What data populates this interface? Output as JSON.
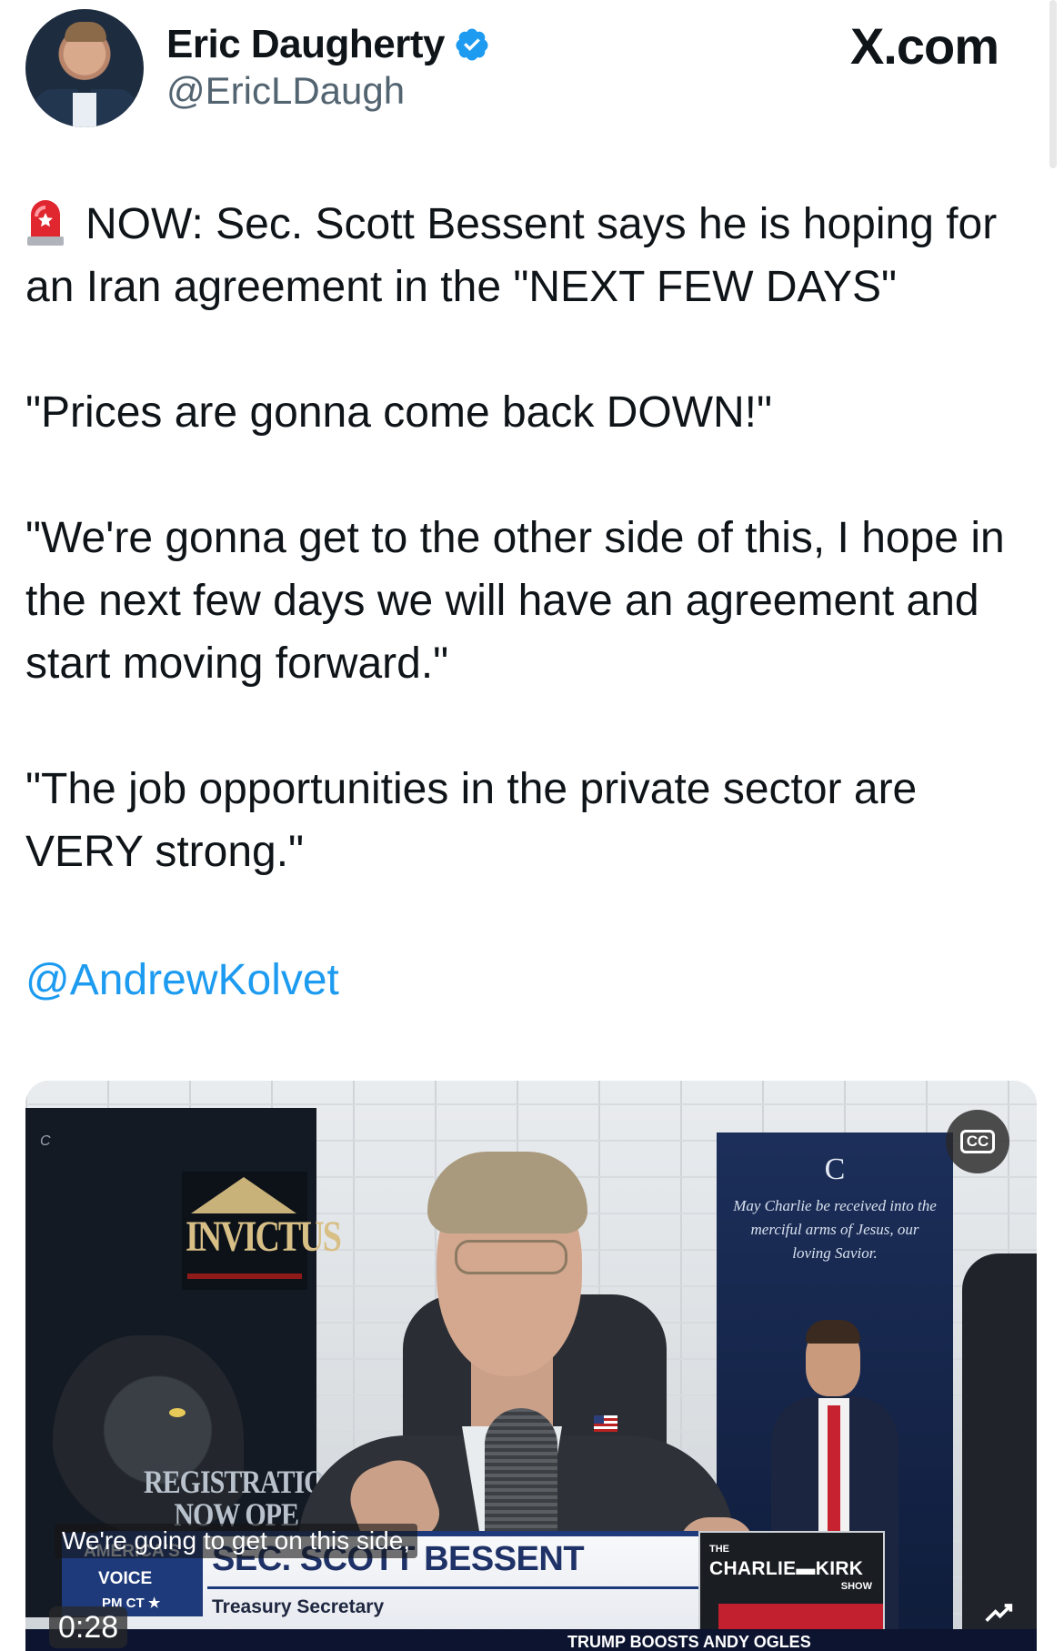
{
  "author": {
    "display_name": "Eric Daugherty",
    "handle": "@EricLDaugh",
    "verified": true
  },
  "brand": "X.com",
  "tweet": {
    "lines": [
      "NOW: Sec. Scott Bessent says he is hoping for an Iran agreement in the \"NEXT FEW DAYS\"",
      "\"Prices are gonna come back DOWN!\"",
      "\"We're gonna get to the other side of this, I hope in the next few days we will have an agreement and start moving forward.\"",
      "\"The job opportunities in the private sector are VERY strong.\""
    ],
    "mention": "@AndrewKolvet"
  },
  "video": {
    "caption": "We're going to get on this side,",
    "timestamp": "0:28",
    "cc_label": "CC",
    "lower_third_name": "SEC. SCOTT BESSENT",
    "lower_third_title": "Treasury Secretary",
    "network_line1": "AMERICA'S",
    "network_line2": "VOICE",
    "network_tz": "PM CT ★",
    "show_the": "THE",
    "show_name": "CHARLIE▬KIRK",
    "show_suffix": "SHOW",
    "ticker": "TRUMP BOOSTS ANDY OGLES",
    "poster_left_title": "INVICTUS",
    "poster_left_reg": "REGISTRATIO NOW OPE",
    "poster_right_quote": "May Charlie be received into the merciful arms of Jesus, our loving Savior.",
    "poster_right_glyph": "C"
  },
  "colors": {
    "link": "#1d9bf0",
    "verified": "#1d9bf0",
    "handle": "#536471",
    "text": "#0f1419"
  },
  "icons": [
    "verified-badge-icon",
    "siren-icon",
    "cc-icon",
    "replay-icon"
  ]
}
